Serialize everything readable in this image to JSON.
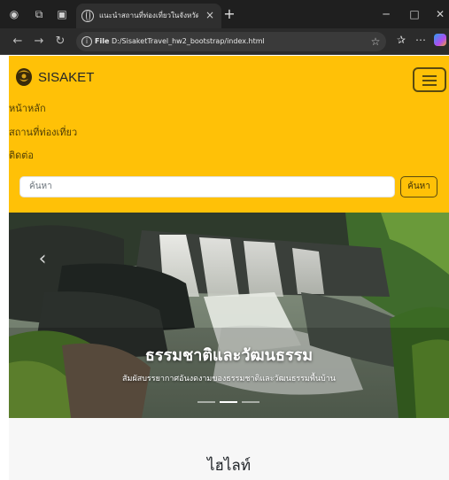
{
  "browser": {
    "tab_title": "แนะนำสถานที่ท่องเที่ยวในจังหวัดศรีสะเกษ",
    "tab_close": "×",
    "new_tab": "+",
    "file_label": "File",
    "url": "D:/SisaketTravel_hw2_bootstrap/index.html",
    "minimize": "─",
    "maximize": "□",
    "close": "✕"
  },
  "site": {
    "brand": "SISAKET",
    "menu": [
      "หน้าหลัก",
      "สถานที่ท่องเที่ยว",
      "ติดต่อ"
    ],
    "search_placeholder": "ค้นหา",
    "search_button": "ค้นหา"
  },
  "carousel": {
    "prev_symbol": "‹",
    "title": "ธรรมชาติและวัฒนธรรม",
    "text": "สัมผัสบรรยากาศอันงดงามของธรรมชาติและวัฒนธรรมพื้นบ้าน",
    "slides": 3,
    "active": 1
  },
  "highlight": {
    "title": "ไฮไลท์"
  },
  "colors": {
    "header": "#ffc107",
    "chrome_dark": "#1f1f1f"
  }
}
